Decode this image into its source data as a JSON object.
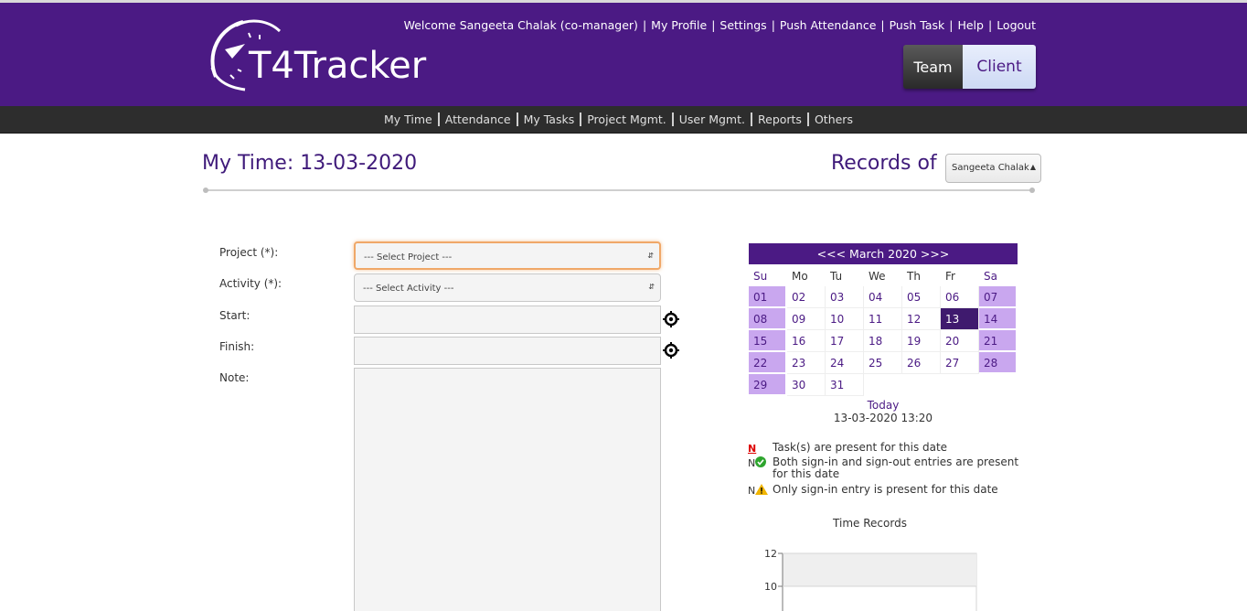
{
  "header": {
    "logo_text": "T4Tracker",
    "links": [
      {
        "label": "Welcome Sangeeta Chalak (co-manager)"
      },
      {
        "label": "My Profile"
      },
      {
        "label": "Settings"
      },
      {
        "label": "Push Attendance"
      },
      {
        "label": "Push Task"
      },
      {
        "label": "Help"
      },
      {
        "label": "Logout"
      }
    ],
    "toggle": {
      "team_label": "Team",
      "client_label": "Client"
    }
  },
  "nav": {
    "items": [
      "My Time",
      "Attendance",
      "My Tasks",
      "Project Mgmt.",
      "User Mgmt.",
      "Reports",
      "Others"
    ]
  },
  "page": {
    "title": "My Time: 13-03-2020",
    "records_label": "Records of",
    "records_select_value": "Sangeeta Chalak"
  },
  "form": {
    "project_label": "Project (*):",
    "project_value": "--- Select Project ---",
    "activity_label": "Activity (*):",
    "activity_value": "--- Select Activity ---",
    "start_label": "Start:",
    "finish_label": "Finish:",
    "note_label": "Note:"
  },
  "calendar": {
    "header": "<<< March 2020 >>>",
    "weekdays": [
      "Su",
      "Mo",
      "Tu",
      "We",
      "Th",
      "Fr",
      "Sa"
    ],
    "days": [
      "01",
      "02",
      "03",
      "04",
      "05",
      "06",
      "07",
      "08",
      "09",
      "10",
      "11",
      "12",
      "13",
      "14",
      "15",
      "16",
      "17",
      "18",
      "19",
      "20",
      "21",
      "22",
      "23",
      "24",
      "25",
      "26",
      "27",
      "28",
      "29",
      "30",
      "31"
    ],
    "selected_day": "13",
    "today_label": "Today",
    "today_value": "13-03-2020 13:20"
  },
  "legend": {
    "items": [
      {
        "mark": "N",
        "text": "Task(s) are present for this date"
      },
      {
        "mark": "N",
        "text": "Both sign-in and sign-out entries are present for this date"
      },
      {
        "mark": "N",
        "text": "Only sign-in entry is present for this date"
      }
    ]
  },
  "chart_title": "Time Records",
  "chart_data": {
    "type": "bar",
    "title": "Time Records",
    "categories": [],
    "values": [],
    "y_ticks": [
      12,
      10
    ],
    "ylim": [
      0,
      12
    ]
  },
  "colors": {
    "brand": "#4b1a84",
    "weekend": "#c9a7ef",
    "selected": "#3f1a6e",
    "focus": "#f0a868"
  }
}
